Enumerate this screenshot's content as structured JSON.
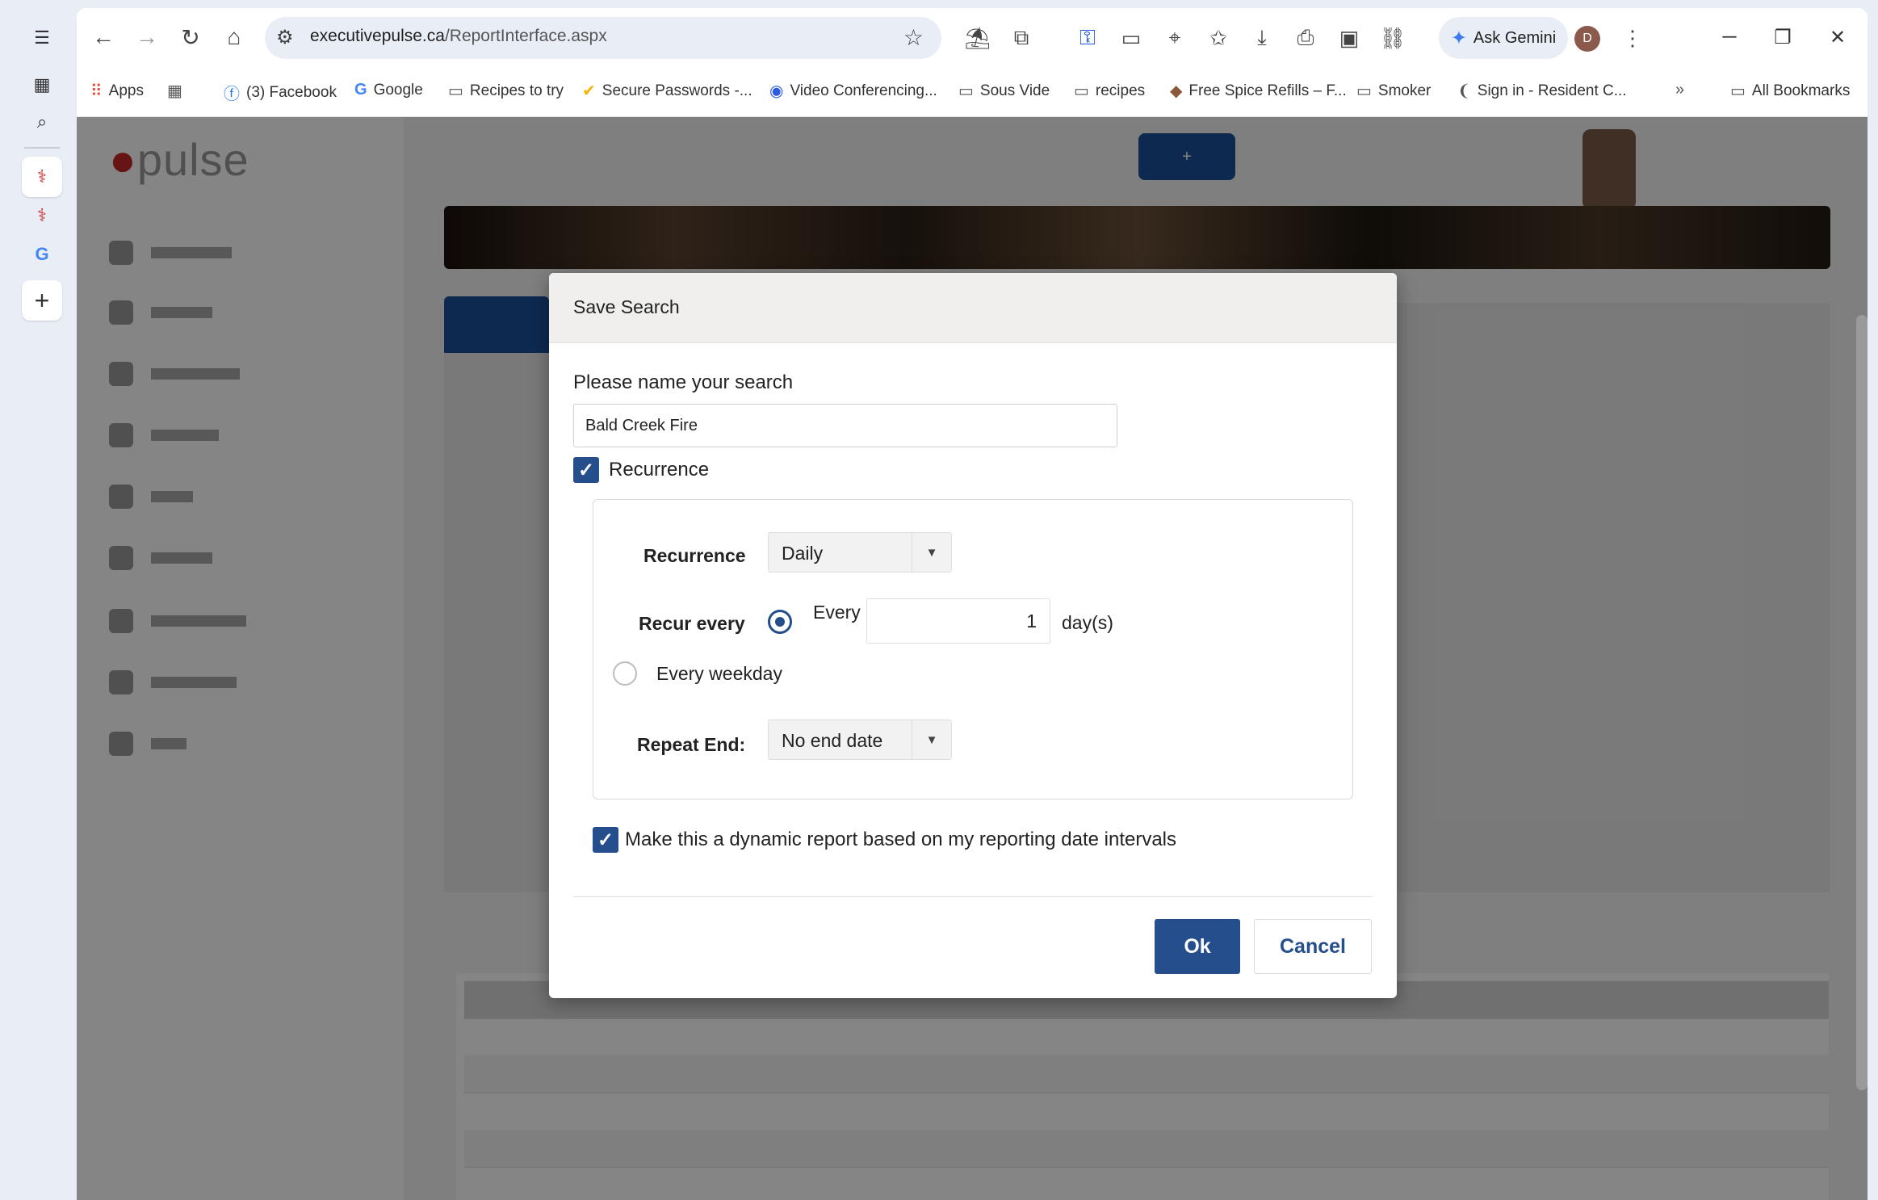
{
  "browser": {
    "url_host": "executivepulse.ca",
    "url_path": "/ReportInterface.aspx",
    "ask_gemini": "Ask Gemini",
    "profile_initial": "D"
  },
  "bookmarks": [
    {
      "label": "Apps",
      "icon": "apps-grid-icon"
    },
    {
      "label": "(3) Facebook",
      "icon": "facebook-icon"
    },
    {
      "label": "Google",
      "icon": "google-icon"
    },
    {
      "label": "Recipes to try",
      "icon": "folder-icon"
    },
    {
      "label": "Secure Passwords -...",
      "icon": "check-badge-icon"
    },
    {
      "label": "Video Conferencing...",
      "icon": "zoom-icon"
    },
    {
      "label": "Sous Vide",
      "icon": "folder-icon"
    },
    {
      "label": "recipes",
      "icon": "folder-icon"
    },
    {
      "label": "Free Spice Refills – F...",
      "icon": "spice-icon"
    },
    {
      "label": "Smoker",
      "icon": "folder-icon"
    },
    {
      "label": "Sign in - Resident C...",
      "icon": "resident-icon"
    }
  ],
  "bookmarks_all": "All Bookmarks",
  "dialog": {
    "title": "Save Search",
    "name_label": "Please name your search",
    "name_value": "Bald Creek Fire",
    "recurrence_checkbox_label": "Recurrence",
    "recurrence_checked": true,
    "recurrence_label": "Recurrence",
    "recurrence_value": "Daily",
    "recur_every_label": "Recur every",
    "every_label": "Every",
    "every_days_value": "1",
    "days_unit": "day(s)",
    "every_weekday_label": "Every weekday",
    "repeat_end_label": "Repeat End:",
    "repeat_end_value": "No end date",
    "dynamic_label": "Make this a dynamic report based on my reporting date intervals",
    "dynamic_checked": true,
    "ok_label": "Ok",
    "cancel_label": "Cancel"
  },
  "colors": {
    "primary": "#244e8c",
    "brand_red": "#c62828"
  }
}
